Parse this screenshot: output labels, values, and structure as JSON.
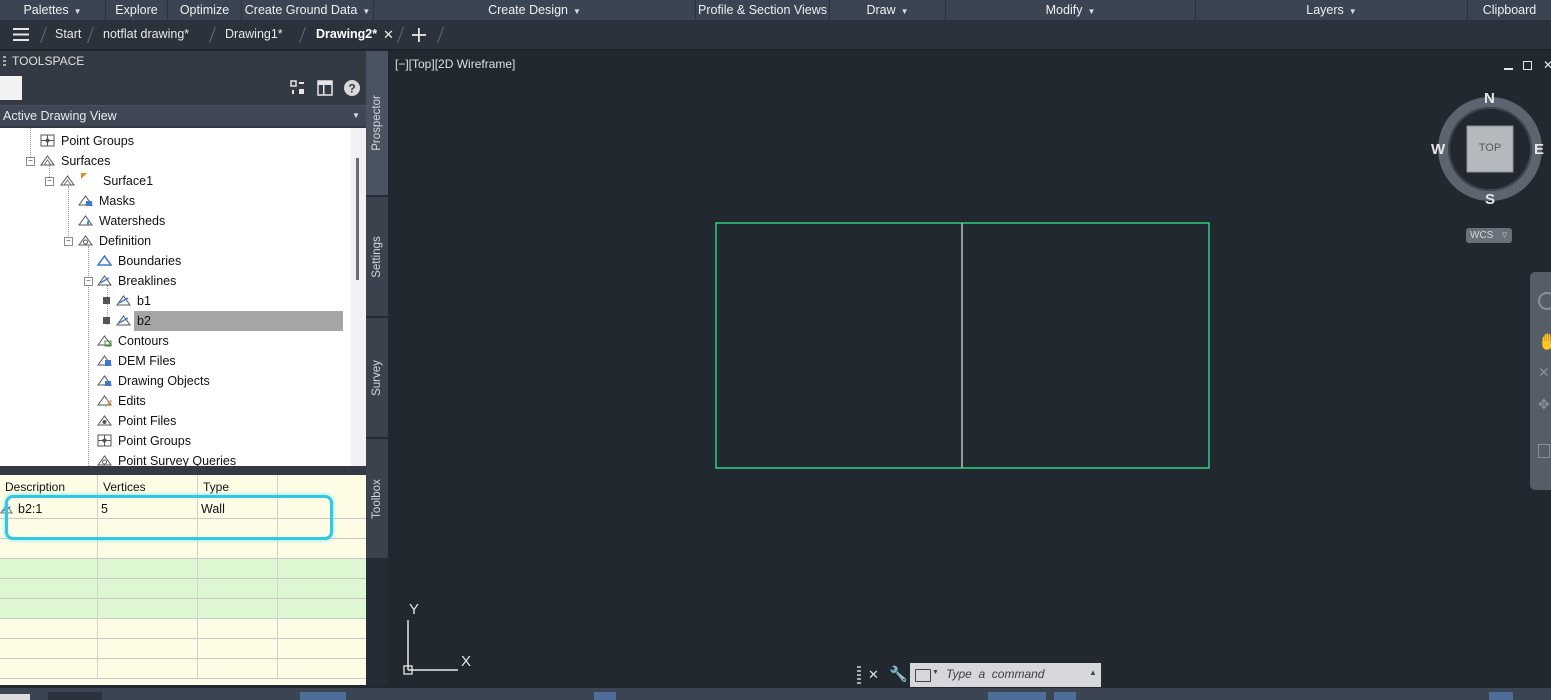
{
  "ribbon": {
    "palettes": "Palettes",
    "explore": "Explore",
    "optimize": "Optimize",
    "create_ground_data": "Create Ground Data",
    "create_design": "Create Design",
    "profile_section_views": "Profile & Section Views",
    "draw": "Draw",
    "modify": "Modify",
    "layers": "Layers",
    "clipboard": "Clipboard"
  },
  "tabs": {
    "start": "Start",
    "notflat": "notflat drawing*",
    "drawing1": "Drawing1*",
    "drawing2": "Drawing2*"
  },
  "toolspace": {
    "title": "TOOLSPACE",
    "view_selector": "Active Drawing View",
    "tree": [
      {
        "label": "Point Groups"
      },
      {
        "label": "Surfaces"
      },
      {
        "label": "Surface1"
      },
      {
        "label": "Masks"
      },
      {
        "label": "Watersheds"
      },
      {
        "label": "Definition"
      },
      {
        "label": "Boundaries"
      },
      {
        "label": "Breaklines"
      },
      {
        "label": "b1"
      },
      {
        "label": "b2"
      },
      {
        "label": "Contours"
      },
      {
        "label": "DEM Files"
      },
      {
        "label": "Drawing Objects"
      },
      {
        "label": "Edits"
      },
      {
        "label": "Point Files"
      },
      {
        "label": "Point Groups"
      },
      {
        "label": "Point Survey Queries"
      }
    ],
    "grid": {
      "columns": [
        "Description",
        "Vertices",
        "Type"
      ],
      "rows": [
        {
          "description": "b2:1",
          "vertices": "5",
          "type": "Wall"
        }
      ]
    }
  },
  "side_tabs": {
    "prospector": "Prospector",
    "settings": "Settings",
    "survey": "Survey",
    "toolbox": "Toolbox"
  },
  "viewport": {
    "label": "[−][Top][2D Wireframe]"
  },
  "viewcube": {
    "north": "N",
    "south": "S",
    "east": "E",
    "west": "W",
    "face": "TOP",
    "wcs": "WCS"
  },
  "ucs": {
    "y": "Y",
    "x": "X"
  },
  "command_line": {
    "placeholder": "Type  a  command"
  },
  "colors": {
    "canvas_bg": "#212830",
    "rectangle_outline": "#2fd07a",
    "divider_line": "#bdbdbd",
    "selection_highlight": "#31c8e6",
    "grid_bg": "#fdfde6",
    "grid_green_row": "#dcf7d2"
  }
}
